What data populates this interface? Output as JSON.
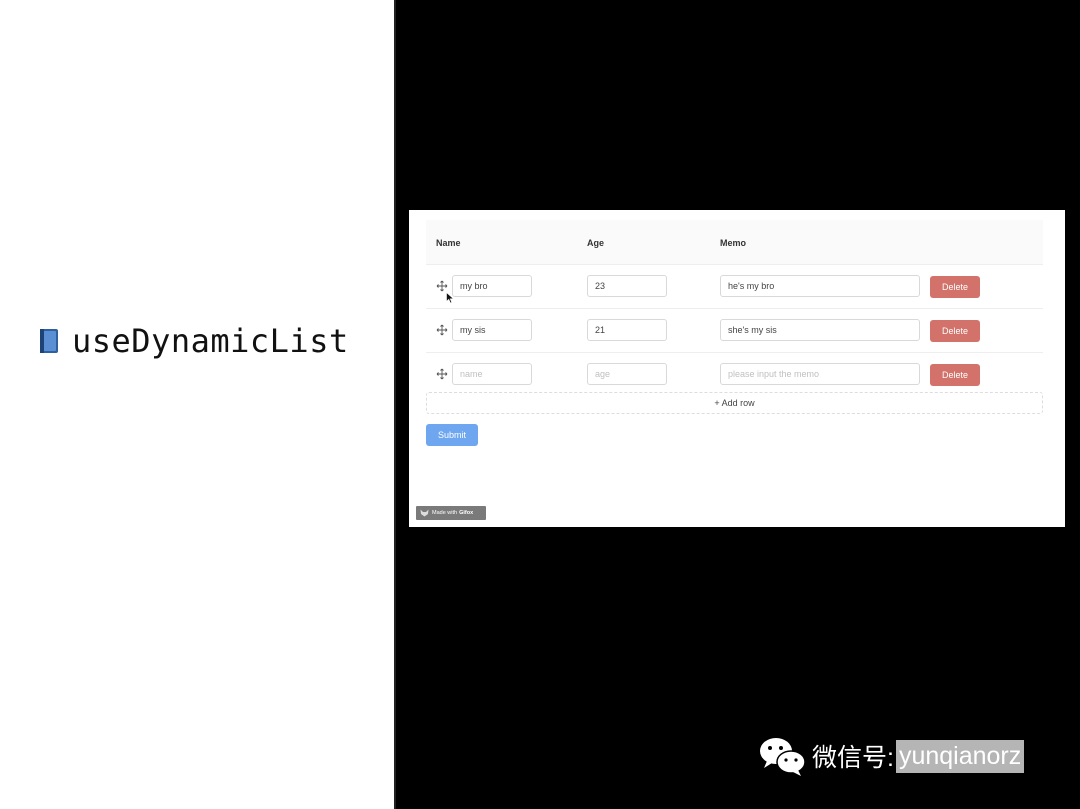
{
  "slide": {
    "title": "useDynamicList",
    "icon": "book-icon"
  },
  "table": {
    "columns": [
      "Name",
      "Age",
      "Memo"
    ],
    "rows": [
      {
        "name": "my bro",
        "age": "23",
        "memo": "he's my bro",
        "delete_label": "Delete"
      },
      {
        "name": "my sis",
        "age": "21",
        "memo": "she's my sis",
        "delete_label": "Delete"
      },
      {
        "name": "",
        "age": "",
        "memo": "",
        "delete_label": "Delete"
      }
    ],
    "placeholders": {
      "name": "name",
      "age": "age",
      "memo": "please input the memo"
    }
  },
  "actions": {
    "add_row_label": "+ Add row",
    "submit_label": "Submit"
  },
  "badge": {
    "made_with": "Made with",
    "brand": "Gifox"
  },
  "watermark": {
    "label": "微信号:",
    "handle": "yunqianorz"
  },
  "colors": {
    "delete": "#d2726a",
    "submit": "#6ea7f0",
    "background": "#000000"
  }
}
